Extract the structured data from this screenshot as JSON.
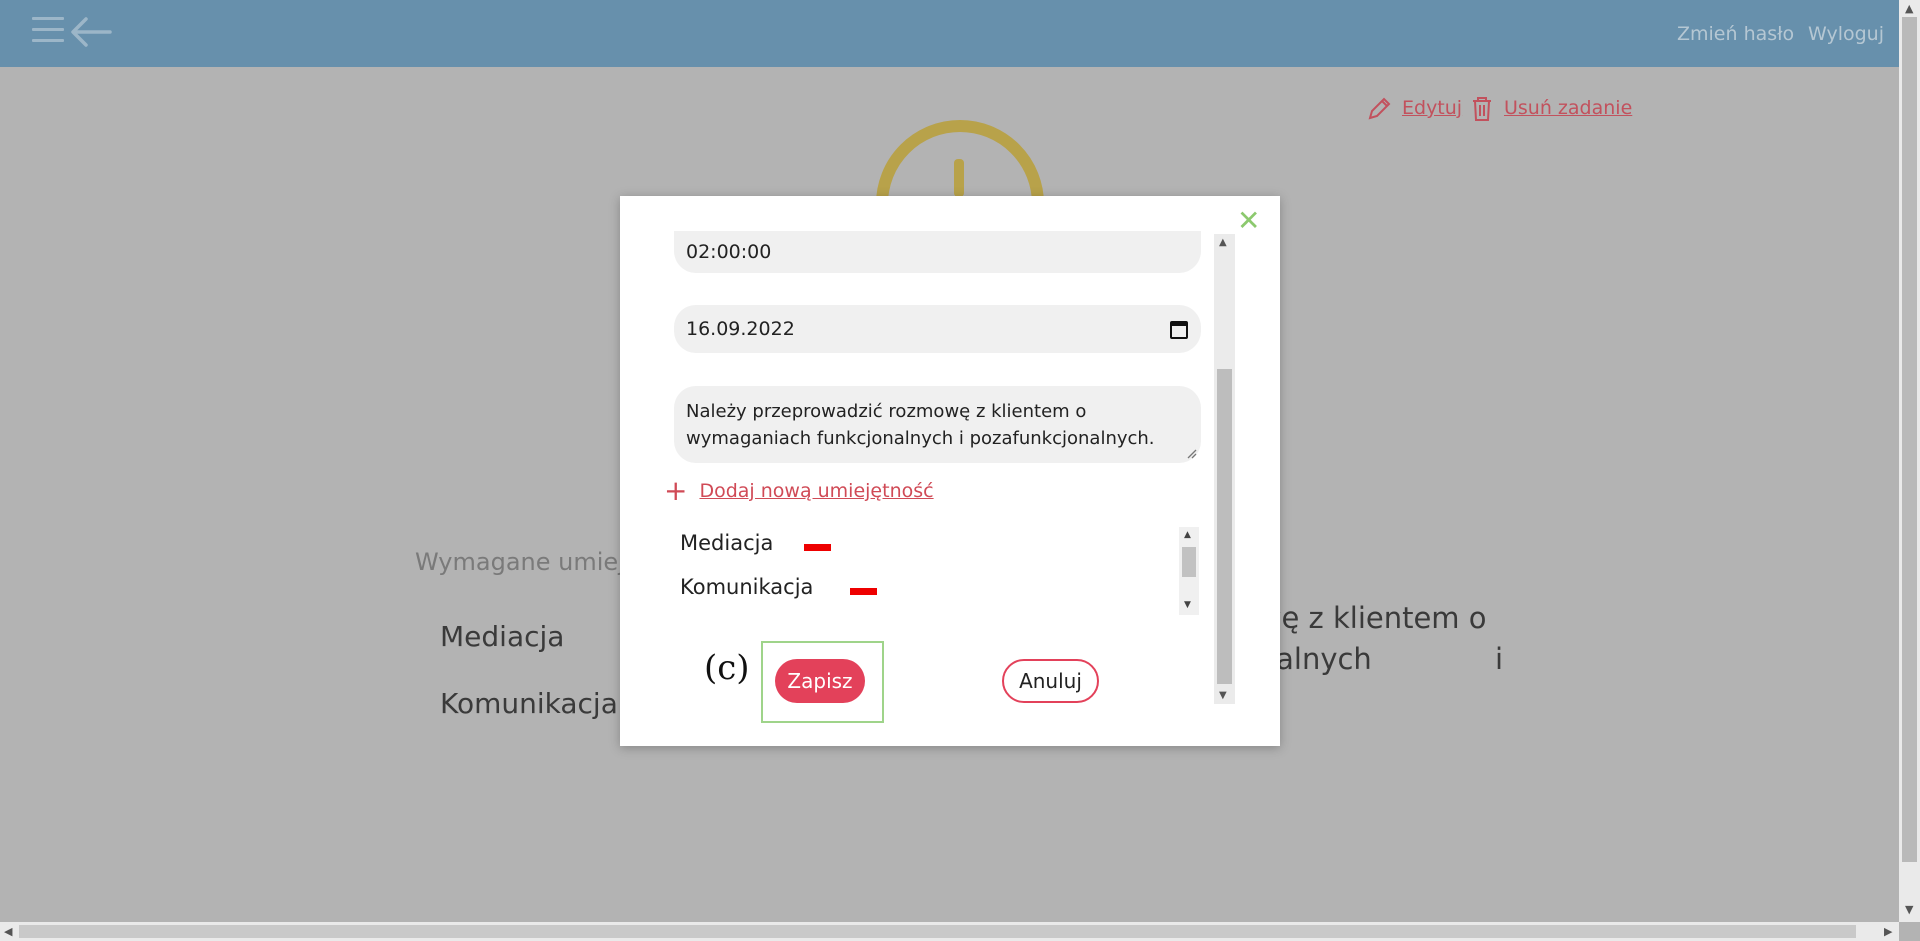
{
  "header": {
    "change_password": "Zmień hasło",
    "logout": "Wyloguj"
  },
  "background": {
    "edit_label": "Edytuj",
    "delete_label": "Usuń zadanie",
    "required_skills_label": "Wymagane umiej",
    "skills": [
      "Mediacja",
      "Komunikacja"
    ],
    "description_line1": "owę z klientem o",
    "description_line2": "onalnych",
    "description_line2_end": "i"
  },
  "modal": {
    "duration_value": "02:00:00",
    "date_value": "16.09.2022",
    "description_value": "Należy przeprowadzić rozmowę z klientem o wymaganiach funkcjonalnych i pozafunkcjonalnych.",
    "add_skill_label": "Dodaj nową umiejętność",
    "skills": [
      "Mediacja",
      "Komunikacja"
    ],
    "caption": "(c)",
    "save_label": "Zapisz",
    "cancel_label": "Anuluj"
  },
  "colors": {
    "topbar": "#6790ac",
    "accent": "#e3415a",
    "close": "#8cc96e",
    "remove": "#ee0000"
  }
}
